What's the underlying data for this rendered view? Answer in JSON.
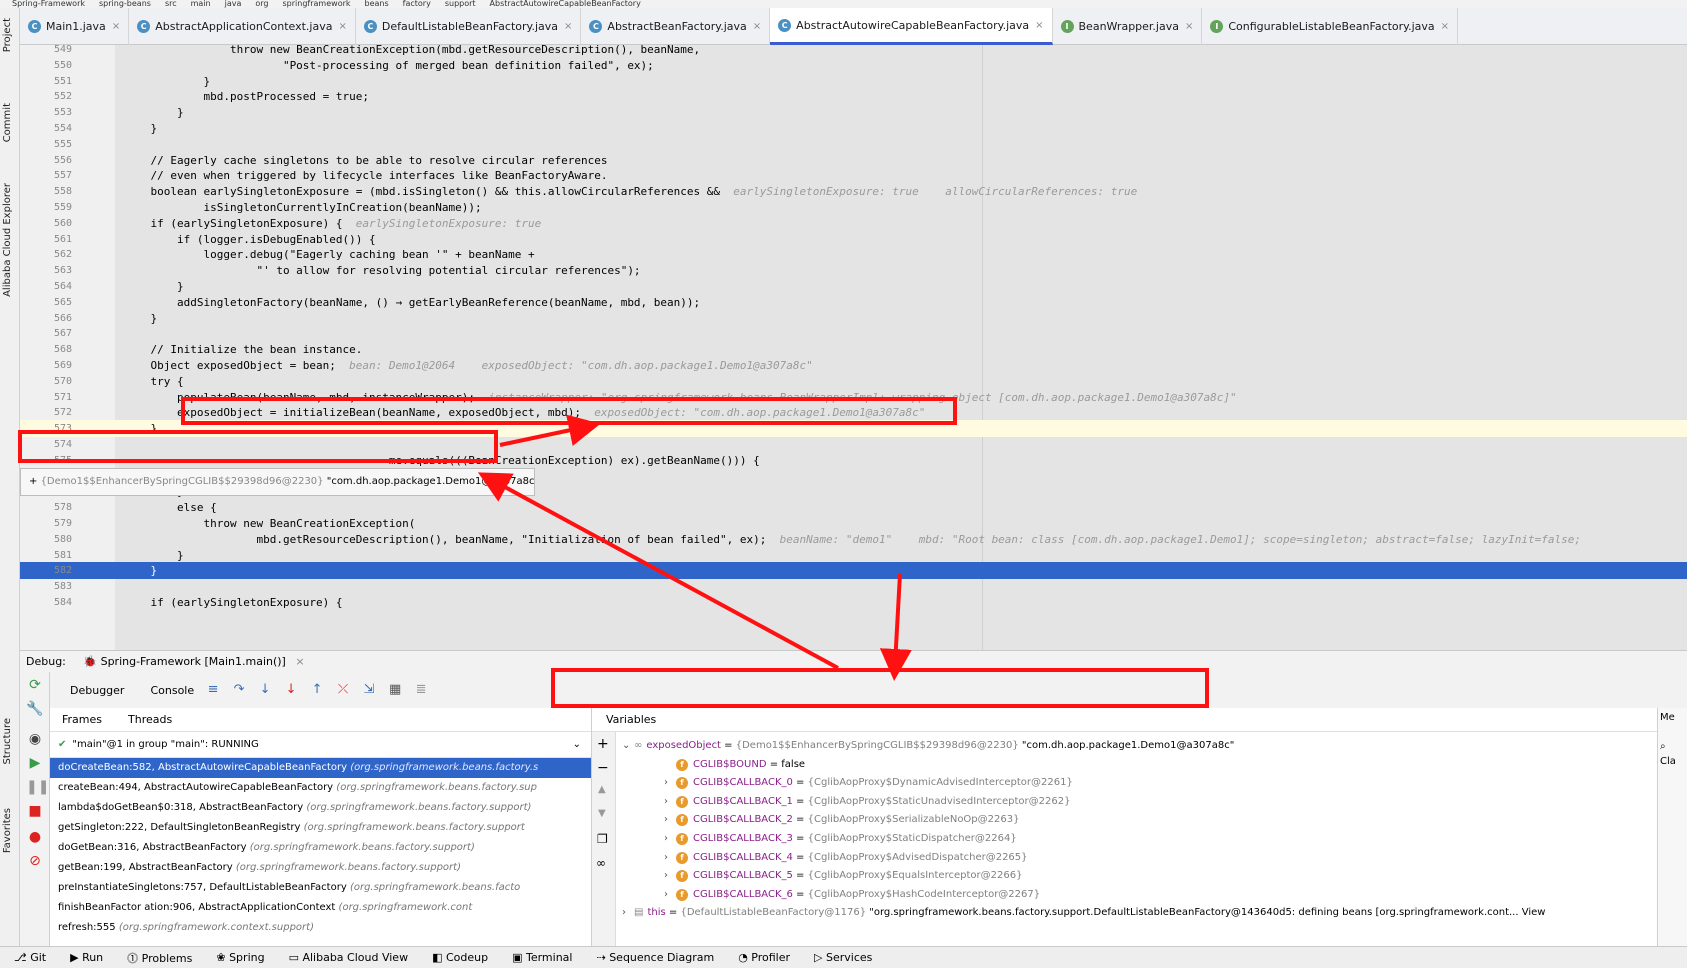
{
  "breadcrumb": [
    "Spring-Framework",
    "spring-beans",
    "src",
    "main",
    "java",
    "org",
    "springframework",
    "beans",
    "factory",
    "support",
    "AbstractAutowireCapableBeanFactory"
  ],
  "left_tabs": [
    "Project",
    "Commit",
    "Alibaba Cloud Explorer",
    "Structure",
    "Favorites"
  ],
  "tabs": [
    {
      "label": "Main1.java",
      "icon": "c"
    },
    {
      "label": "AbstractApplicationContext.java",
      "icon": "c"
    },
    {
      "label": "DefaultListableBeanFactory.java",
      "icon": "c"
    },
    {
      "label": "AbstractBeanFactory.java",
      "icon": "c"
    },
    {
      "label": "AbstractAutowireCapableBeanFactory.java",
      "icon": "c",
      "active": true
    },
    {
      "label": "BeanWrapper.java",
      "icon": "i"
    },
    {
      "label": "ConfigurableListableBeanFactory.java",
      "icon": "i"
    }
  ],
  "code_lines": [
    {
      "n": "549",
      "text": "                throw new BeanCreationException(mbd.getResourceDescription(), beanName,",
      "hint": ""
    },
    {
      "n": "550",
      "text": "                        \"Post-processing of merged bean definition failed\", ex);",
      "hint": ""
    },
    {
      "n": "551",
      "text": "            }",
      "hint": ""
    },
    {
      "n": "552",
      "text": "            mbd.postProcessed = true;",
      "hint": ""
    },
    {
      "n": "553",
      "text": "        }",
      "hint": ""
    },
    {
      "n": "554",
      "text": "    }",
      "hint": ""
    },
    {
      "n": "555",
      "text": "",
      "hint": ""
    },
    {
      "n": "556",
      "text": "    // Eagerly cache singletons to be able to resolve circular references",
      "hint": ""
    },
    {
      "n": "557",
      "text": "    // even when triggered by lifecycle interfaces like BeanFactoryAware.",
      "hint": ""
    },
    {
      "n": "558",
      "text": "    boolean earlySingletonExposure = (mbd.isSingleton() && this.allowCircularReferences &&",
      "hint": "earlySingletonExposure: true    allowCircularReferences: true"
    },
    {
      "n": "559",
      "text": "            isSingletonCurrentlyInCreation(beanName));",
      "hint": ""
    },
    {
      "n": "560",
      "text": "    if (earlySingletonExposure) {",
      "hint": "earlySingletonExposure: true"
    },
    {
      "n": "561",
      "text": "        if (logger.isDebugEnabled()) {",
      "hint": ""
    },
    {
      "n": "562",
      "text": "            logger.debug(\"Eagerly caching bean '\" + beanName +",
      "hint": ""
    },
    {
      "n": "563",
      "text": "                    \"' to allow for resolving potential circular references\");",
      "hint": ""
    },
    {
      "n": "564",
      "text": "        }",
      "hint": ""
    },
    {
      "n": "565",
      "text": "        addSingletonFactory(beanName, () → getEarlyBeanReference(beanName, mbd, bean));",
      "hint": ""
    },
    {
      "n": "566",
      "text": "    }",
      "hint": ""
    },
    {
      "n": "567",
      "text": "",
      "hint": ""
    },
    {
      "n": "568",
      "text": "    // Initialize the bean instance.",
      "hint": ""
    },
    {
      "n": "569",
      "text": "    Object exposedObject = bean;",
      "hint": "bean: Demo1@2064    exposedObject: \"com.dh.aop.package1.Demo1@a307a8c\""
    },
    {
      "n": "570",
      "text": "    try {",
      "hint": ""
    },
    {
      "n": "571",
      "text": "        populateBean(beanName, mbd, instanceWrapper);",
      "hint": "instanceWrapper: \"org.springframework.beans.BeanWrapperImpl: wrapping object [com.dh.aop.package1.Demo1@a307a8c]\""
    },
    {
      "n": "572",
      "text": "        exposedObject = initializeBean(beanName, exposedObject, mbd);",
      "hint": "exposedObject: \"com.dh.aop.package1.Demo1@a307a8c\""
    },
    {
      "n": "573",
      "text": "    }",
      "hint": ""
    },
    {
      "n": "574",
      "text": "",
      "hint": ""
    },
    {
      "n": "575",
      "text": "                                        me.equals(((BeanCreationException) ex).getBeanName())) {",
      "hint": ""
    },
    {
      "n": "576",
      "text": "            throw (BeanCreationException) ex;",
      "hint": ""
    },
    {
      "n": "577",
      "text": "        }",
      "hint": ""
    },
    {
      "n": "578",
      "text": "        else {",
      "hint": ""
    },
    {
      "n": "579",
      "text": "            throw new BeanCreationException(",
      "hint": ""
    },
    {
      "n": "580",
      "text": "                    mbd.getResourceDescription(), beanName, \"Initialization of bean failed\", ex);",
      "hint": "beanName: \"demo1\"    mbd: \"Root bean: class [com.dh.aop.package1.Demo1]; scope=singleton; abstract=false; lazyInit=false;"
    },
    {
      "n": "581",
      "text": "        }",
      "hint": ""
    },
    {
      "n": "582",
      "text": "    }",
      "hint": ""
    },
    {
      "n": "583",
      "text": "",
      "hint": ""
    },
    {
      "n": "584",
      "text": "    if (earlySingletonExposure) {",
      "hint": ""
    }
  ],
  "tooltip": {
    "type": "{Demo1$$EnhancerBySpringCGLIB$$29398d96@2230}",
    "value": "\"com.dh.aop.package1.Demo1@a307a8c\""
  },
  "debug": {
    "label": "Debug:",
    "session": "Spring-Framework [Main1.main()]",
    "tabs": [
      "Debugger",
      "Console"
    ],
    "frames_tab": "Frames",
    "threads_tab": "Threads",
    "thread": "\"main\"@1 in group \"main\": RUNNING",
    "frames": [
      {
        "m": "doCreateBean:582, AbstractAutowireCapableBeanFactory",
        "p": "(org.springframework.beans.factory.s",
        "sel": true
      },
      {
        "m": "createBean:494, AbstractAutowireCapableBeanFactory",
        "p": "(org.springframework.beans.factory.sup"
      },
      {
        "m": "lambda$doGetBean$0:318, AbstractBeanFactory",
        "p": "(org.springframework.beans.factory.support)"
      },
      {
        "m": "getSingleton:222, DefaultSingletonBeanRegistry",
        "p": "(org.springframework.beans.factory.support"
      },
      {
        "m": "doGetBean:316, AbstractBeanFactory",
        "p": "(org.springframework.beans.factory.support)"
      },
      {
        "m": "getBean:199, AbstractBeanFactory",
        "p": "(org.springframework.beans.factory.support)"
      },
      {
        "m": "preInstantiateSingletons:757, DefaultListableBeanFactory",
        "p": "(org.springframework.beans.facto"
      },
      {
        "m": "finishBeanFactor  ation:906, AbstractApplicationContext",
        "p": "(org.springframework.cont"
      },
      {
        "m": "refresh:555",
        "p": "(org.springframework.context.support)"
      }
    ],
    "variables_title": "Variables",
    "variables": [
      {
        "name": "exposedObject",
        "type": "{Demo1$$EnhancerBySpringCGLIB$$29398d96@2230}",
        "value": "\"com.dh.aop.package1.Demo1@a307a8c\"",
        "level": 0,
        "expanded": true
      },
      {
        "name": "CGLIB$BOUND",
        "type": "",
        "value": "= false",
        "level": 1
      },
      {
        "name": "CGLIB$CALLBACK_0",
        "type": "{CglibAopProxy$DynamicAdvisedInterceptor@2261}",
        "value": "",
        "level": 1
      },
      {
        "name": "CGLIB$CALLBACK_1",
        "type": "{CglibAopProxy$StaticUnadvisedInterceptor@2262}",
        "value": "",
        "level": 1
      },
      {
        "name": "CGLIB$CALLBACK_2",
        "type": "{CglibAopProxy$SerializableNoOp@2263}",
        "value": "",
        "level": 1
      },
      {
        "name": "CGLIB$CALLBACK_3",
        "type": "{CglibAopProxy$StaticDispatcher@2264}",
        "value": "",
        "level": 1
      },
      {
        "name": "CGLIB$CALLBACK_4",
        "type": "{CglibAopProxy$AdvisedDispatcher@2265}",
        "value": "",
        "level": 1
      },
      {
        "name": "CGLIB$CALLBACK_5",
        "type": "{CglibAopProxy$EqualsInterceptor@2266}",
        "value": "",
        "level": 1
      },
      {
        "name": "CGLIB$CALLBACK_6",
        "type": "{CglibAopProxy$HashCodeInterceptor@2267}",
        "value": "",
        "level": 1
      },
      {
        "name": "this",
        "type": "{DefaultListableBeanFactory@1176}",
        "value": "\"org.springframework.beans.factory.support.DefaultListableBeanFactory@143640d5: defining beans [org.springframework.cont... View",
        "level": 0
      }
    ],
    "memory_label": "Me",
    "memory_hint": "Cla"
  },
  "bottom_bar": [
    "Git",
    "Run",
    "Problems",
    "Spring",
    "Alibaba Cloud View",
    "Codeup",
    "Terminal",
    "Sequence Diagram",
    "Profiler",
    "Services"
  ],
  "colors": {
    "annotation": "#ff1111",
    "selection": "#2f65c9",
    "tab_accent": "#3b5ccf"
  }
}
